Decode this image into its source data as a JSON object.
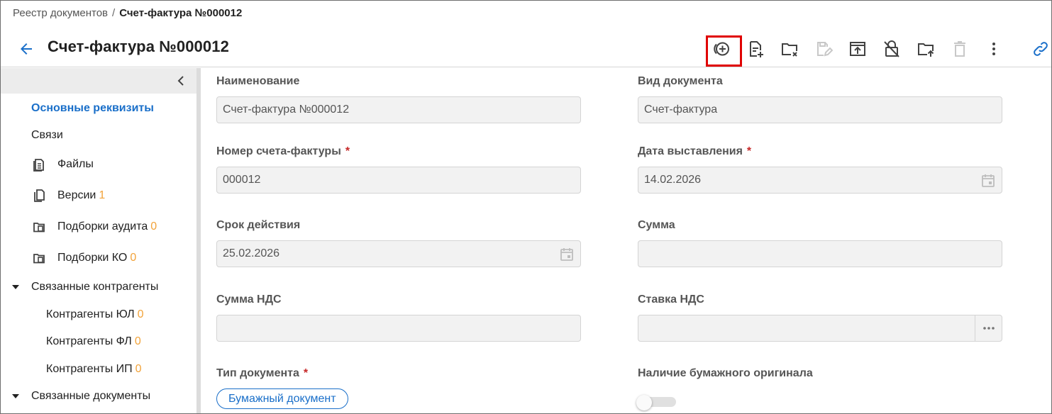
{
  "breadcrumb": {
    "parent": "Реестр документов",
    "separator": "/",
    "current": "Счет-фактура №000012"
  },
  "header": {
    "title": "Счет-фактура №000012"
  },
  "toolbar": {
    "buttons": [
      {
        "icon": "add-circle-icon",
        "highlighted": true
      },
      {
        "icon": "document-add-icon"
      },
      {
        "icon": "folder-remove-icon"
      },
      {
        "icon": "document-edit-icon",
        "disabled": true
      },
      {
        "icon": "upload-window-icon"
      },
      {
        "icon": "lock-off-icon"
      },
      {
        "icon": "folder-upload-icon"
      },
      {
        "icon": "trash-icon",
        "disabled": true
      },
      {
        "icon": "more-vertical-icon"
      }
    ],
    "link_icon": "link-icon"
  },
  "sidebar": {
    "items": [
      {
        "label": "Основные реквизиты",
        "active": true
      },
      {
        "label": "Связи"
      },
      {
        "label": "Файлы",
        "icon": "document-icon"
      },
      {
        "label": "Версии",
        "count": "1",
        "icon": "copy-icon"
      },
      {
        "label": "Подборки аудита",
        "count": "0",
        "icon": "folder-copy-icon"
      },
      {
        "label": "Подборки КО",
        "count": "0",
        "icon": "folder-copy-icon"
      },
      {
        "label": "Связанные контрагенты",
        "expandable": true
      },
      {
        "label": "Контрагенты ЮЛ",
        "count": "0"
      },
      {
        "label": "Контрагенты ФЛ",
        "count": "0"
      },
      {
        "label": "Контрагенты ИП",
        "count": "0"
      },
      {
        "label": "Связанные документы",
        "expandable": true
      }
    ]
  },
  "form": {
    "name": {
      "label": "Наименование",
      "value": "Счет-фактура №000012"
    },
    "doc_kind": {
      "label": "Вид документа",
      "value": "Счет-фактура"
    },
    "invoice_number": {
      "label": "Номер счета-фактуры",
      "required": "*",
      "value": "000012"
    },
    "issue_date": {
      "label": "Дата выставления",
      "required": "*",
      "value": "14.02.2026"
    },
    "validity": {
      "label": "Срок действия",
      "value": "25.02.2026"
    },
    "amount": {
      "label": "Сумма",
      "value": ""
    },
    "vat_amount": {
      "label": "Сумма НДС",
      "value": ""
    },
    "vat_rate": {
      "label": "Ставка НДС",
      "value": ""
    },
    "doc_type": {
      "label": "Тип документа",
      "required": "*",
      "value": "Бумажный документ"
    },
    "paper_original": {
      "label": "Наличие бумажного оригинала",
      "value": false
    }
  },
  "colors": {
    "accent": "#1a6fc9",
    "count": "#f2a33a",
    "required": "#c62828",
    "highlight": "#e00000"
  }
}
